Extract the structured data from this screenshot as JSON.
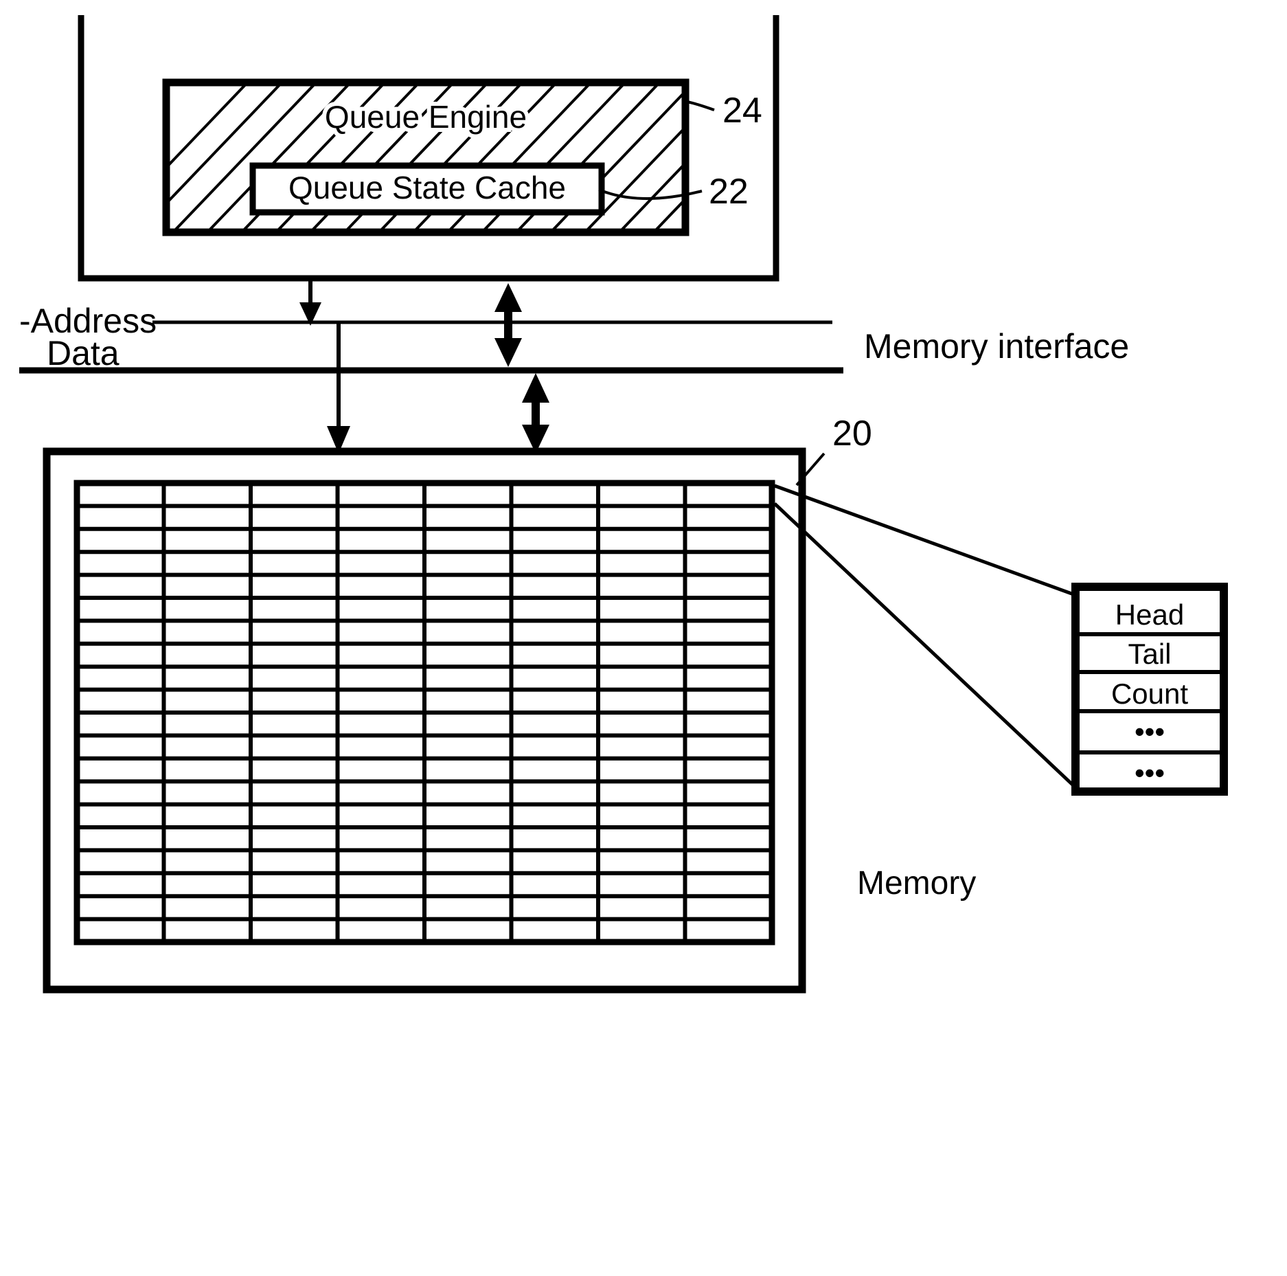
{
  "figure": {
    "type": "patent-block-diagram",
    "background_color": "#ffffff",
    "line_color": "#000000"
  },
  "controller": {
    "name": "controller-enclosure",
    "queue_engine": {
      "label": "Queue Engine",
      "ref_number": "24",
      "fill": "hatched"
    },
    "queue_state_cache": {
      "label": "Queue State Cache",
      "ref_number": "22",
      "fill": "white"
    }
  },
  "bus": {
    "address_label": "-Address",
    "data_label": "Data",
    "interface_label": "Memory interface"
  },
  "memory": {
    "label": "Memory",
    "ref_number": "20",
    "grid": {
      "columns": 8,
      "rows": 20
    }
  },
  "queue_descriptor": {
    "name": "queue-state-descriptor",
    "rows": [
      "Head",
      "Tail",
      "Count",
      "•••",
      "•••"
    ]
  }
}
